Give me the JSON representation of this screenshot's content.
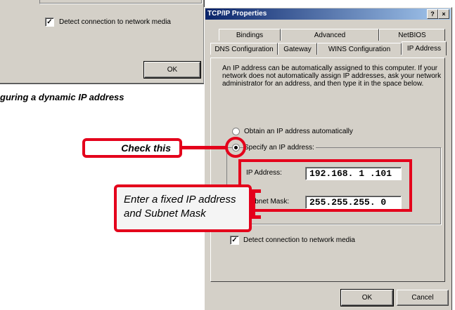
{
  "background_dialog": {
    "detect_checkbox_label": "Detect connection to network media",
    "ok_label": "OK"
  },
  "caption": "guring a dynamic IP address",
  "dialog": {
    "title": "TCP/IP Properties",
    "help_button": "?",
    "close_button": "×",
    "tabs_row1": [
      "Bindings",
      "Advanced",
      "NetBIOS"
    ],
    "tabs_row2": [
      "DNS Configuration",
      "Gateway",
      "WINS Configuration",
      "IP Address"
    ],
    "description": "An IP address can be automatically assigned to this computer. If your network does not automatically assign IP addresses, ask your network administrator for an address, and then type it in the space below.",
    "radio_auto_label": "Obtain an IP address automatically",
    "radio_specify_label": "Specify an IP address:",
    "ip_label": "IP Address:",
    "ip_value": "192.168. 1 .101",
    "mask_label": "Subnet Mask:",
    "mask_value": "255.255.255. 0",
    "detect_label": "Detect connection to network media",
    "ok_label": "OK",
    "cancel_label": "Cancel"
  },
  "callouts": {
    "check_this": "Check this",
    "enter_fixed": "Enter a fixed IP address and Subnet Mask"
  },
  "colors": {
    "accent_red": "#e4001b",
    "title_blue": "#0a246a",
    "dialog_gray": "#d4d0c8"
  }
}
